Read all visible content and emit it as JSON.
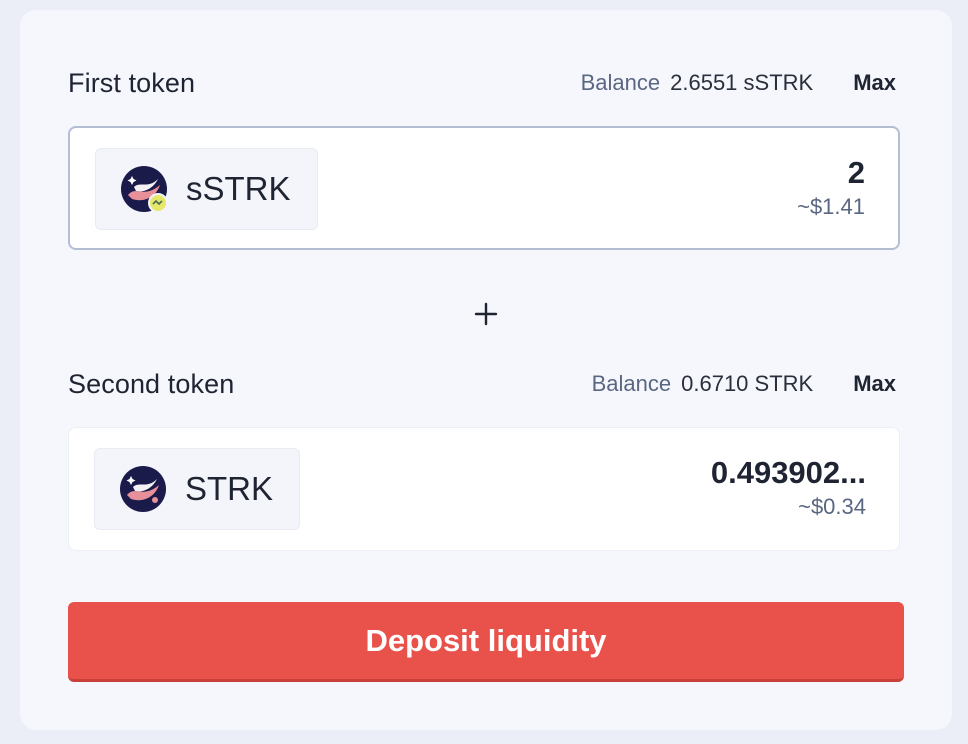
{
  "first": {
    "label": "First token",
    "balance_label": "Balance",
    "balance_value": "2.6551 sSTRK",
    "max_label": "Max",
    "token_symbol": "sSTRK",
    "amount": "2",
    "amount_usd": "~$1.41"
  },
  "separator_icon": "plus-icon",
  "second": {
    "label": "Second token",
    "balance_label": "Balance",
    "balance_value": "0.6710 STRK",
    "max_label": "Max",
    "token_symbol": "STRK",
    "amount": "0.493902...",
    "amount_usd": "~$0.34"
  },
  "deposit_label": "Deposit liquidity",
  "colors": {
    "primary_button": "#e9514b",
    "token_icon_bg": "#1b1b4b",
    "token_icon_stripe": "#e8909a",
    "staked_badge": "#e6e86a",
    "secondary_text": "#5a6782"
  }
}
